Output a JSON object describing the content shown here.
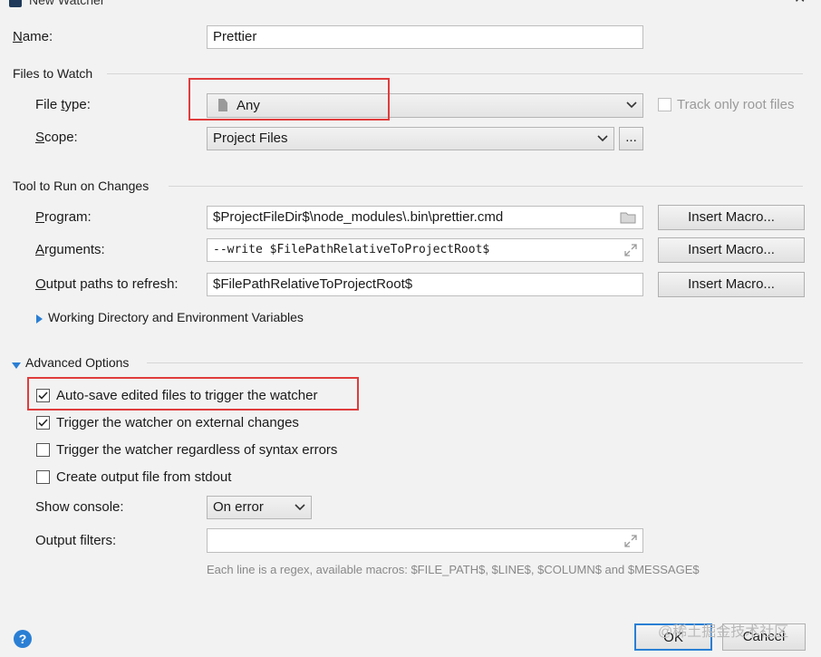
{
  "window": {
    "title": "New Watcher"
  },
  "name": {
    "label": "Name:",
    "value": "Prettier"
  },
  "files_to_watch": {
    "section_title": "Files to Watch",
    "file_type_label": "File type:",
    "file_type_value": "Any",
    "track_only_root_label": "Track only root files",
    "track_only_root_checked": false,
    "scope_label": "Scope:",
    "scope_value": "Project Files",
    "scope_browse_label": "..."
  },
  "tool": {
    "section_title": "Tool to Run on Changes",
    "program_label": "Program:",
    "program_value": "$ProjectFileDir$\\node_modules\\.bin\\prettier.cmd",
    "arguments_label": "Arguments:",
    "arguments_value": "--write $FilePathRelativeToProjectRoot$",
    "output_paths_label": "Output paths to refresh:",
    "output_paths_value": "$FilePathRelativeToProjectRoot$",
    "insert_macro_label": "Insert Macro...",
    "working_dir_label": "Working Directory and Environment Variables"
  },
  "advanced": {
    "section_title": "Advanced Options",
    "options": [
      {
        "label": "Auto-save edited files to trigger the watcher",
        "checked": true
      },
      {
        "label": "Trigger the watcher on external changes",
        "checked": true
      },
      {
        "label": "Trigger the watcher regardless of syntax errors",
        "checked": false
      },
      {
        "label": "Create output file from stdout",
        "checked": false
      }
    ],
    "show_console_label": "Show console:",
    "show_console_value": "On error",
    "output_filters_label": "Output filters:",
    "output_filters_value": "",
    "hint": "Each line is a regex, available macros: $FILE_PATH$, $LINE$, $COLUMN$ and $MESSAGE$"
  },
  "footer": {
    "help_label": "?",
    "ok_label": "OK",
    "cancel_label": "Cancel",
    "watermark": "@稀土掘金技术社区"
  },
  "colors": {
    "highlight": "#e03c3c",
    "accent": "#2a7fd4"
  }
}
